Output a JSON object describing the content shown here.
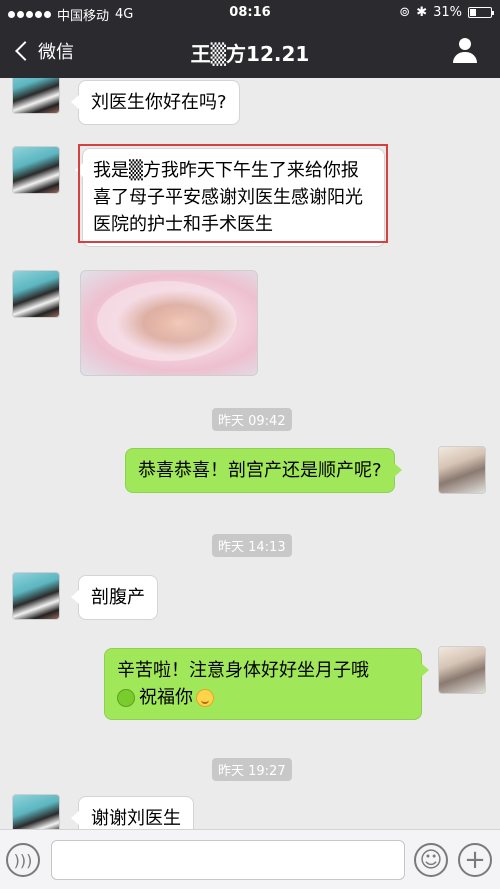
{
  "status_bar": {
    "carrier": "中国移动",
    "network": "4G",
    "time": "08:16",
    "battery": "31%",
    "battery_level": 0.31
  },
  "nav": {
    "back_label": "微信",
    "title": "王▒方12.21"
  },
  "messages": {
    "m1": "刘医生你好在吗?",
    "m2": "我是▒方我昨天下午生了来给你报喜了母子平安感谢刘医生感谢阳光医院的护士和手术医生",
    "m4": "恭喜恭喜！剖宫产还是顺产呢?",
    "m5": "剖腹产",
    "m6_line1": "辛苦啦！注意身体好好坐月子哦",
    "m6_line2": "祝福你",
    "m7": "谢谢刘医生"
  },
  "timestamps": {
    "t1": "昨天 09:42",
    "t2": "昨天 14:13",
    "t3": "昨天 19:27"
  },
  "icons": {
    "signal": "signal-dots-icon",
    "lock": "orientation-lock-icon",
    "bluetooth": "bluetooth-icon",
    "battery": "battery-icon",
    "back": "chevron-left-icon",
    "user": "user-icon",
    "voice": "voice-icon",
    "emoji": "emoji-icon",
    "plus": "plus-icon"
  },
  "colors": {
    "nav_bg": "#2b2b2f",
    "chat_bg": "#ebebeb",
    "sent_bubble": "#a0e75a",
    "highlight_border": "#d64040"
  }
}
